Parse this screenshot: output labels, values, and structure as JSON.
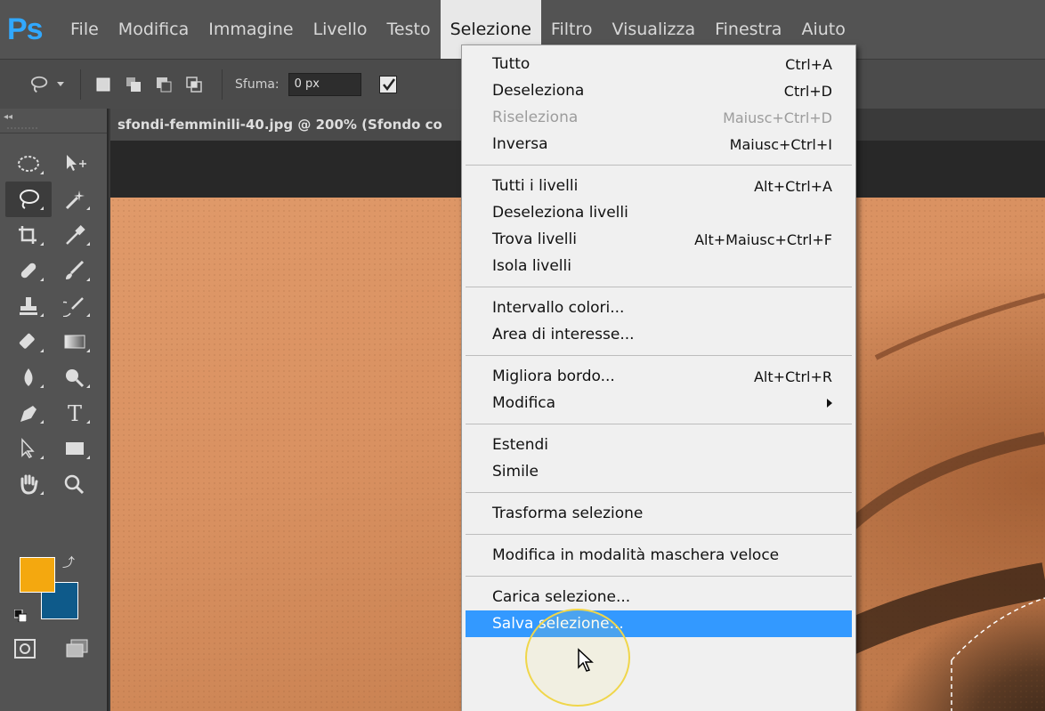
{
  "app": {
    "logo": "Ps"
  },
  "menubar": {
    "items": [
      "File",
      "Modifica",
      "Immagine",
      "Livello",
      "Testo",
      "Selezione",
      "Filtro",
      "Visualizza",
      "Finestra",
      "Aiuto"
    ],
    "active": "Selezione"
  },
  "options_bar": {
    "feather_label": "Sfuma:",
    "feather_value": "0 px"
  },
  "document": {
    "tab_title": "sfondi-femminili-40.jpg @ 200% (Sfondo co"
  },
  "colors": {
    "foreground": "#f4a80f",
    "background": "#0e5a8a",
    "accent": "#3399ff"
  },
  "selection_menu": {
    "groups": [
      [
        {
          "label": "Tutto",
          "shortcut": "Ctrl+A"
        },
        {
          "label": "Deseleziona",
          "shortcut": "Ctrl+D"
        },
        {
          "label": "Riseleziona",
          "shortcut": "Maiusc+Ctrl+D",
          "disabled": true
        },
        {
          "label": "Inversa",
          "shortcut": "Maiusc+Ctrl+I"
        }
      ],
      [
        {
          "label": "Tutti i livelli",
          "shortcut": "Alt+Ctrl+A"
        },
        {
          "label": "Deseleziona livelli",
          "shortcut": ""
        },
        {
          "label": "Trova livelli",
          "shortcut": "Alt+Maiusc+Ctrl+F"
        },
        {
          "label": "Isola livelli",
          "shortcut": ""
        }
      ],
      [
        {
          "label": "Intervallo colori...",
          "shortcut": ""
        },
        {
          "label": "Area di interesse...",
          "shortcut": ""
        }
      ],
      [
        {
          "label": "Migliora bordo...",
          "shortcut": "Alt+Ctrl+R"
        },
        {
          "label": "Modifica",
          "shortcut": "",
          "submenu": true
        }
      ],
      [
        {
          "label": "Estendi",
          "shortcut": ""
        },
        {
          "label": "Simile",
          "shortcut": ""
        }
      ],
      [
        {
          "label": "Trasforma selezione",
          "shortcut": ""
        }
      ],
      [
        {
          "label": "Modifica in modalità maschera veloce",
          "shortcut": ""
        }
      ],
      [
        {
          "label": "Carica selezione...",
          "shortcut": ""
        },
        {
          "label": "Salva selezione...",
          "shortcut": "",
          "highlighted": true
        }
      ]
    ]
  }
}
